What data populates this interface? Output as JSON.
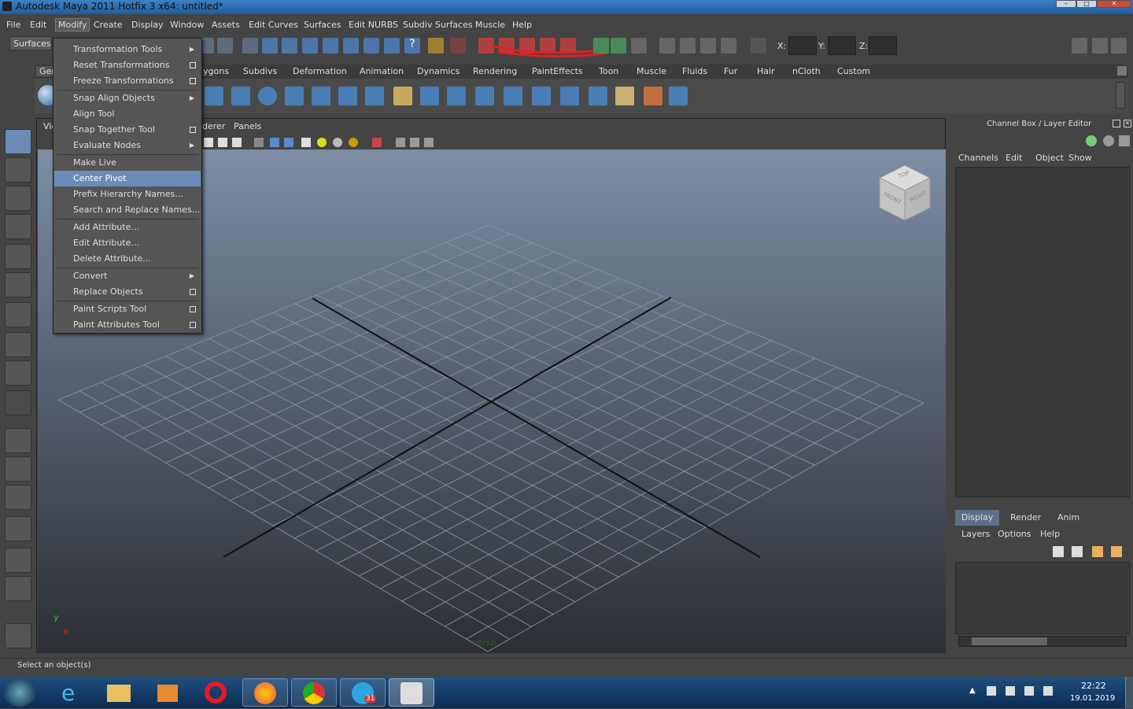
{
  "window": {
    "title": "Autodesk Maya 2011 Hotfix 3 x64: untitled*"
  },
  "menubar": {
    "items": [
      "File",
      "Edit",
      "Modify",
      "Create",
      "Display",
      "Window",
      "Assets",
      "Edit Curves",
      "Surfaces",
      "Edit NURBS",
      "Subdiv Surfaces",
      "Muscle",
      "Help"
    ]
  },
  "status": {
    "mode": "Surfaces",
    "x_label": "X:",
    "y_label": "Y:",
    "z_label": "Z:"
  },
  "shelf_tabs": [
    "Gen",
    "ygons",
    "Subdivs",
    "Deformation",
    "Animation",
    "Dynamics",
    "Rendering",
    "PaintEffects",
    "Toon",
    "Muscle",
    "Fluids",
    "Fur",
    "Hair",
    "nCloth",
    "Custom"
  ],
  "viewport": {
    "menu": [
      "Vie",
      "derer",
      "Panels"
    ],
    "camera_label": "persp",
    "cube_faces": [
      "TOP",
      "FRONT",
      "RIGHT"
    ],
    "axis_x": "x",
    "axis_y": "y"
  },
  "modify_menu": {
    "items": [
      {
        "label": "Transformation Tools",
        "submenu": true,
        "options": false
      },
      {
        "label": "Reset Transformations",
        "submenu": false,
        "options": true
      },
      {
        "label": "Freeze Transformations",
        "submenu": false,
        "options": true
      },
      {
        "label": "Snap Align Objects",
        "submenu": true,
        "options": false
      },
      {
        "label": "Align Tool",
        "submenu": false,
        "options": false
      },
      {
        "label": "Snap Together Tool",
        "submenu": false,
        "options": true
      },
      {
        "label": "Evaluate Nodes",
        "submenu": true,
        "options": false
      },
      {
        "label": "Make Live",
        "submenu": false,
        "options": false
      },
      {
        "label": "Center Pivot",
        "submenu": false,
        "options": false,
        "highlighted": true
      },
      {
        "label": "Prefix Hierarchy Names...",
        "submenu": false,
        "options": false
      },
      {
        "label": "Search and Replace Names...",
        "submenu": false,
        "options": false
      },
      {
        "label": "Add Attribute...",
        "submenu": false,
        "options": false
      },
      {
        "label": "Edit Attribute...",
        "submenu": false,
        "options": false
      },
      {
        "label": "Delete Attribute...",
        "submenu": false,
        "options": false
      },
      {
        "label": "Convert",
        "submenu": true,
        "options": false
      },
      {
        "label": "Replace Objects",
        "submenu": false,
        "options": true
      },
      {
        "label": "Paint Scripts Tool",
        "submenu": false,
        "options": true
      },
      {
        "label": "Paint Attributes Tool",
        "submenu": false,
        "options": true
      }
    ]
  },
  "channel_box": {
    "title": "Channel Box / Layer Editor",
    "menu": [
      "Channels",
      "Edit",
      "Object",
      "Show"
    ]
  },
  "layer_editor": {
    "tabs": [
      "Display",
      "Render",
      "Anim"
    ],
    "menu": [
      "Layers",
      "Options",
      "Help"
    ]
  },
  "helpline": {
    "text": "Select an object(s)"
  },
  "taskbar": {
    "time": "22:22",
    "date": "19.01.2019",
    "badge": "31"
  },
  "colors": {
    "highlight": "#6b8cb8",
    "annotation": "#e02020",
    "titlebar": "#2a6aad"
  }
}
